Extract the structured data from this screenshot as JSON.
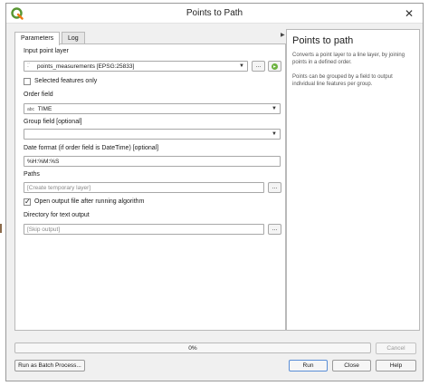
{
  "window": {
    "title": "Points to Path",
    "close_glyph": "✕"
  },
  "tabs": [
    {
      "label": "Parameters",
      "active": true
    },
    {
      "label": "Log",
      "active": false
    }
  ],
  "form": {
    "input_layer_label": "Input point layer",
    "input_layer_value": "points_measurements [EPSG:25833]",
    "browse_glyph": "...",
    "selected_features_label": "Selected features only",
    "selected_features_checked": false,
    "order_field_label": "Order field",
    "order_field_type": "abc",
    "order_field_value": "TIME",
    "group_field_label": "Group field [optional]",
    "group_field_value": "",
    "date_format_label": "Date format (if order field is DateTime) [optional]",
    "date_format_value": "%H:%M:%S",
    "paths_label": "Paths",
    "paths_placeholder": "[Create temporary layer]",
    "open_output_label": "Open output file after running algorithm",
    "open_output_checked": true,
    "directory_label": "Directory for text output",
    "directory_placeholder": "[Skip output]"
  },
  "help": {
    "title": "Points to path",
    "paragraph1": "Converts a point layer to a line layer, by joining points in a defined order.",
    "paragraph2": "Points can be grouped by a field to output individual line features per group."
  },
  "progress": {
    "value": 0,
    "label": "0%"
  },
  "buttons": {
    "cancel": "Cancel",
    "batch": "Run as Batch Process...",
    "run": "Run",
    "close": "Close",
    "help": "Help"
  },
  "colors": {
    "qgis_green": "#589632",
    "qgis_yellow": "#ee7913"
  }
}
